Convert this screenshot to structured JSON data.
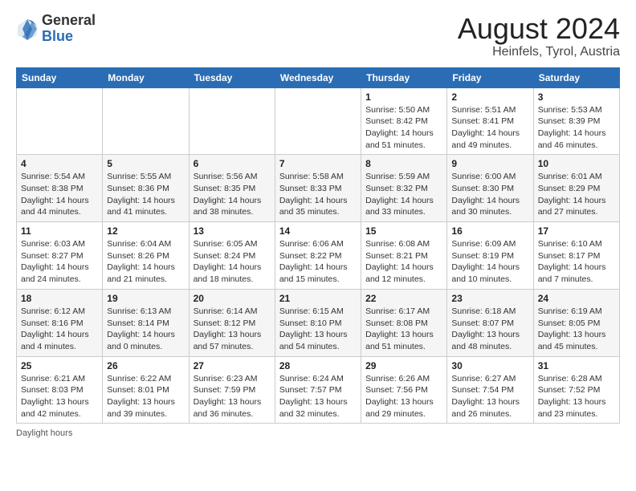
{
  "header": {
    "logo_general": "General",
    "logo_blue": "Blue",
    "title": "August 2024",
    "subtitle": "Heinfels, Tyrol, Austria"
  },
  "calendar": {
    "days_of_week": [
      "Sunday",
      "Monday",
      "Tuesday",
      "Wednesday",
      "Thursday",
      "Friday",
      "Saturday"
    ],
    "weeks": [
      [
        {
          "day": "",
          "info": ""
        },
        {
          "day": "",
          "info": ""
        },
        {
          "day": "",
          "info": ""
        },
        {
          "day": "",
          "info": ""
        },
        {
          "day": "1",
          "info": "Sunrise: 5:50 AM\nSunset: 8:42 PM\nDaylight: 14 hours and 51 minutes."
        },
        {
          "day": "2",
          "info": "Sunrise: 5:51 AM\nSunset: 8:41 PM\nDaylight: 14 hours and 49 minutes."
        },
        {
          "day": "3",
          "info": "Sunrise: 5:53 AM\nSunset: 8:39 PM\nDaylight: 14 hours and 46 minutes."
        }
      ],
      [
        {
          "day": "4",
          "info": "Sunrise: 5:54 AM\nSunset: 8:38 PM\nDaylight: 14 hours and 44 minutes."
        },
        {
          "day": "5",
          "info": "Sunrise: 5:55 AM\nSunset: 8:36 PM\nDaylight: 14 hours and 41 minutes."
        },
        {
          "day": "6",
          "info": "Sunrise: 5:56 AM\nSunset: 8:35 PM\nDaylight: 14 hours and 38 minutes."
        },
        {
          "day": "7",
          "info": "Sunrise: 5:58 AM\nSunset: 8:33 PM\nDaylight: 14 hours and 35 minutes."
        },
        {
          "day": "8",
          "info": "Sunrise: 5:59 AM\nSunset: 8:32 PM\nDaylight: 14 hours and 33 minutes."
        },
        {
          "day": "9",
          "info": "Sunrise: 6:00 AM\nSunset: 8:30 PM\nDaylight: 14 hours and 30 minutes."
        },
        {
          "day": "10",
          "info": "Sunrise: 6:01 AM\nSunset: 8:29 PM\nDaylight: 14 hours and 27 minutes."
        }
      ],
      [
        {
          "day": "11",
          "info": "Sunrise: 6:03 AM\nSunset: 8:27 PM\nDaylight: 14 hours and 24 minutes."
        },
        {
          "day": "12",
          "info": "Sunrise: 6:04 AM\nSunset: 8:26 PM\nDaylight: 14 hours and 21 minutes."
        },
        {
          "day": "13",
          "info": "Sunrise: 6:05 AM\nSunset: 8:24 PM\nDaylight: 14 hours and 18 minutes."
        },
        {
          "day": "14",
          "info": "Sunrise: 6:06 AM\nSunset: 8:22 PM\nDaylight: 14 hours and 15 minutes."
        },
        {
          "day": "15",
          "info": "Sunrise: 6:08 AM\nSunset: 8:21 PM\nDaylight: 14 hours and 12 minutes."
        },
        {
          "day": "16",
          "info": "Sunrise: 6:09 AM\nSunset: 8:19 PM\nDaylight: 14 hours and 10 minutes."
        },
        {
          "day": "17",
          "info": "Sunrise: 6:10 AM\nSunset: 8:17 PM\nDaylight: 14 hours and 7 minutes."
        }
      ],
      [
        {
          "day": "18",
          "info": "Sunrise: 6:12 AM\nSunset: 8:16 PM\nDaylight: 14 hours and 4 minutes."
        },
        {
          "day": "19",
          "info": "Sunrise: 6:13 AM\nSunset: 8:14 PM\nDaylight: 14 hours and 0 minutes."
        },
        {
          "day": "20",
          "info": "Sunrise: 6:14 AM\nSunset: 8:12 PM\nDaylight: 13 hours and 57 minutes."
        },
        {
          "day": "21",
          "info": "Sunrise: 6:15 AM\nSunset: 8:10 PM\nDaylight: 13 hours and 54 minutes."
        },
        {
          "day": "22",
          "info": "Sunrise: 6:17 AM\nSunset: 8:08 PM\nDaylight: 13 hours and 51 minutes."
        },
        {
          "day": "23",
          "info": "Sunrise: 6:18 AM\nSunset: 8:07 PM\nDaylight: 13 hours and 48 minutes."
        },
        {
          "day": "24",
          "info": "Sunrise: 6:19 AM\nSunset: 8:05 PM\nDaylight: 13 hours and 45 minutes."
        }
      ],
      [
        {
          "day": "25",
          "info": "Sunrise: 6:21 AM\nSunset: 8:03 PM\nDaylight: 13 hours and 42 minutes."
        },
        {
          "day": "26",
          "info": "Sunrise: 6:22 AM\nSunset: 8:01 PM\nDaylight: 13 hours and 39 minutes."
        },
        {
          "day": "27",
          "info": "Sunrise: 6:23 AM\nSunset: 7:59 PM\nDaylight: 13 hours and 36 minutes."
        },
        {
          "day": "28",
          "info": "Sunrise: 6:24 AM\nSunset: 7:57 PM\nDaylight: 13 hours and 32 minutes."
        },
        {
          "day": "29",
          "info": "Sunrise: 6:26 AM\nSunset: 7:56 PM\nDaylight: 13 hours and 29 minutes."
        },
        {
          "day": "30",
          "info": "Sunrise: 6:27 AM\nSunset: 7:54 PM\nDaylight: 13 hours and 26 minutes."
        },
        {
          "day": "31",
          "info": "Sunrise: 6:28 AM\nSunset: 7:52 PM\nDaylight: 13 hours and 23 minutes."
        }
      ]
    ]
  },
  "footer": {
    "note": "Daylight hours"
  }
}
